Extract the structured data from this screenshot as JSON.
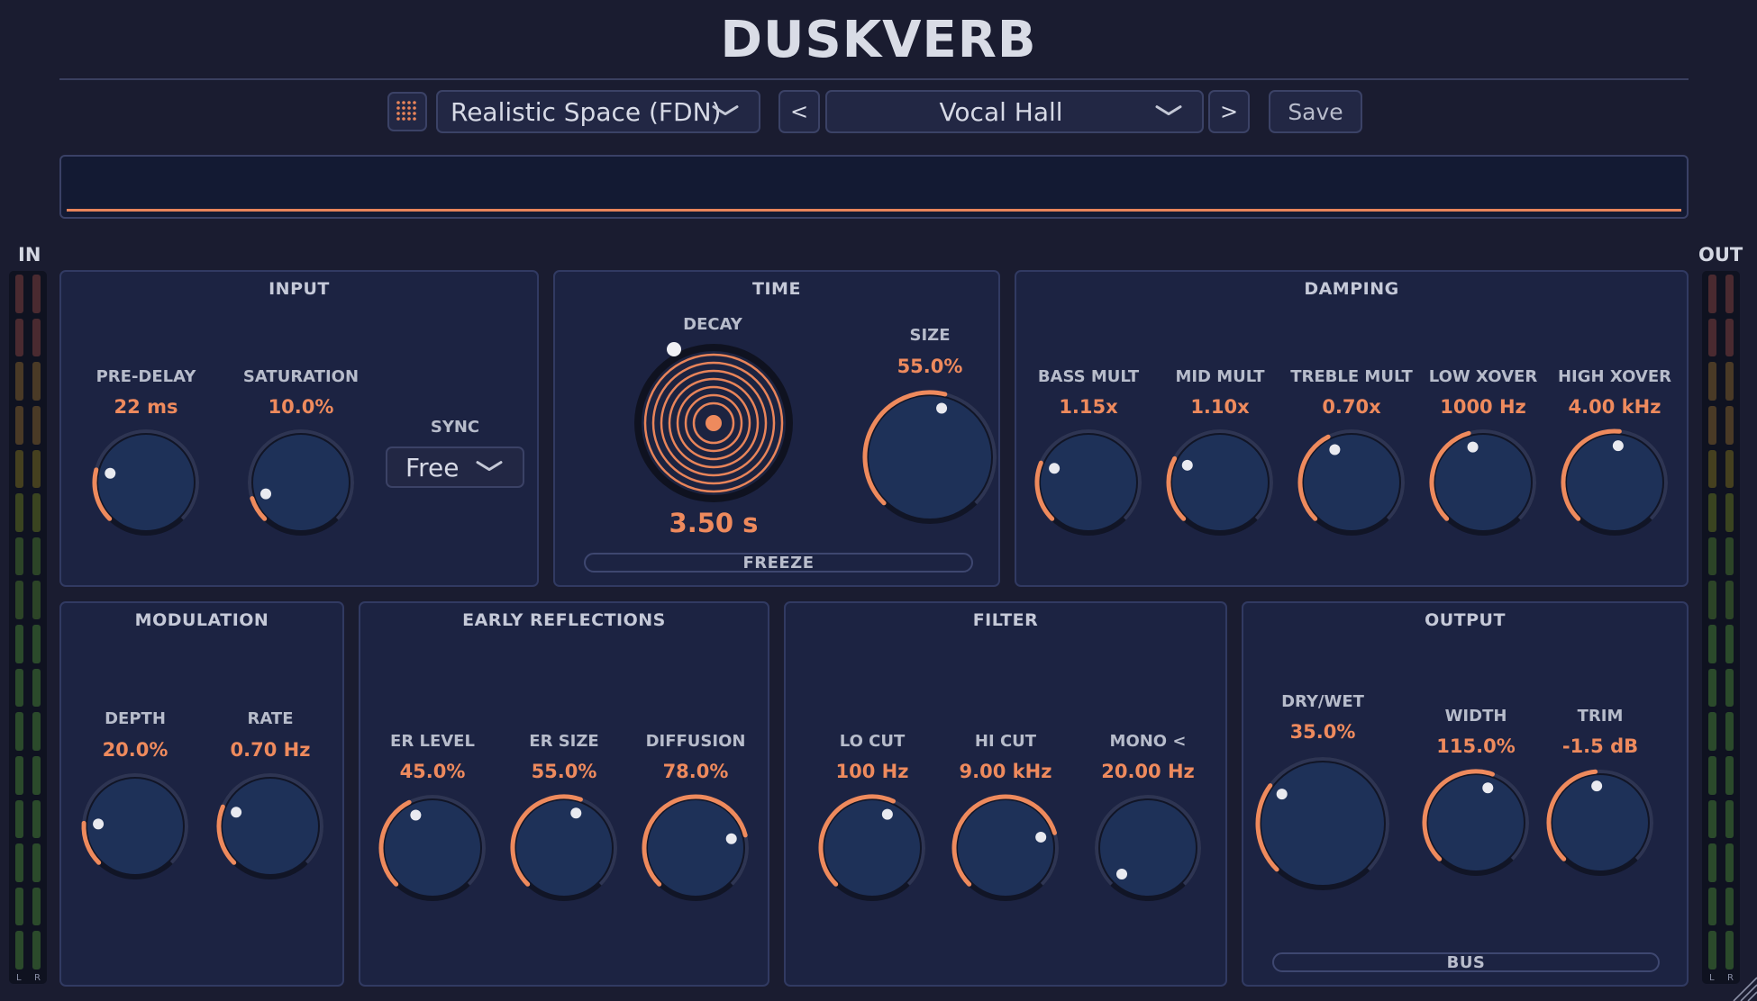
{
  "app": {
    "title": "DUSKVERB"
  },
  "toolbar": {
    "algorithm": "Realistic Space (FDN)",
    "prev": "<",
    "preset": "Vocal Hall",
    "next": ">",
    "save": "Save"
  },
  "meters": {
    "in_label": "IN",
    "out_label": "OUT",
    "l": "L",
    "r": "R"
  },
  "panels": {
    "input": {
      "title": "INPUT",
      "pre_delay": {
        "label": "PRE-DELAY",
        "value": "22 ms",
        "level": 0.22
      },
      "saturation": {
        "label": "SATURATION",
        "value": "10.0%",
        "level": 0.1
      },
      "sync": {
        "label": "SYNC",
        "value": "Free"
      }
    },
    "time": {
      "title": "TIME",
      "decay": {
        "label": "DECAY",
        "value": "3.50 s"
      },
      "size": {
        "label": "SIZE",
        "value": "55.0%",
        "level": 0.55
      },
      "freeze": "FREEZE"
    },
    "damping": {
      "title": "DAMPING",
      "bass_mult": {
        "label": "BASS MULT",
        "value": "1.15x",
        "level": 0.25
      },
      "mid_mult": {
        "label": "MID MULT",
        "value": "1.10x",
        "level": 0.27
      },
      "treble_mult": {
        "label": "TREBLE MULT",
        "value": "0.70x",
        "level": 0.4
      },
      "low_xover": {
        "label": "LOW XOVER",
        "value": "1000 Hz",
        "level": 0.44
      },
      "high_xover": {
        "label": "HIGH XOVER",
        "value": "4.00 kHz",
        "level": 0.52
      }
    },
    "modulation": {
      "title": "MODULATION",
      "depth": {
        "label": "DEPTH",
        "value": "20.0%",
        "level": 0.18
      },
      "rate": {
        "label": "RATE",
        "value": "0.70 Hz",
        "level": 0.25
      }
    },
    "early_reflections": {
      "title": "EARLY REFLECTIONS",
      "er_level": {
        "label": "ER LEVEL",
        "value": "45.0%",
        "level": 0.4
      },
      "er_size": {
        "label": "ER SIZE",
        "value": "55.0%",
        "level": 0.57
      },
      "diffusion": {
        "label": "DIFFUSION",
        "value": "78.0%",
        "level": 0.78
      }
    },
    "filter": {
      "title": "FILTER",
      "lo_cut": {
        "label": "LO CUT",
        "value": "100 Hz",
        "level": 0.59
      },
      "hi_cut": {
        "label": "HI CUT",
        "value": "9.00 kHz",
        "level": 0.77
      },
      "mono": {
        "label": "MONO <",
        "value": "20.00 Hz",
        "level": 0.0
      }
    },
    "output": {
      "title": "OUTPUT",
      "dry_wet": {
        "label": "DRY/WET",
        "value": "35.0%",
        "level": 0.3
      },
      "width": {
        "label": "WIDTH",
        "value": "115.0%",
        "level": 0.57
      },
      "trim": {
        "label": "TRIM",
        "value": "-1.5 dB",
        "level": 0.48
      },
      "bus": "BUS"
    }
  },
  "colors": {
    "accent": "#ee8a5d",
    "panel": "#1c2342",
    "knob_face": "#1e3158",
    "background": "#1a1c30"
  }
}
